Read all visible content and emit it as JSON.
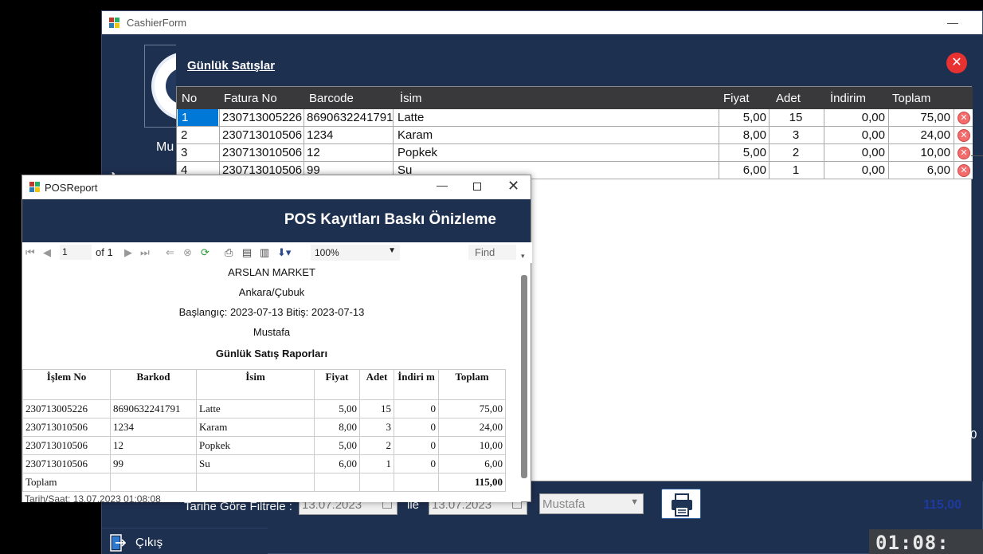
{
  "cashier": {
    "title": "CashierForm",
    "minimize": "—",
    "user_partial": "Mu",
    "exit_label": "Çıkış",
    "clock": "01:08:",
    "stray_text": "0"
  },
  "gunluk": {
    "title": "Günlük Satışlar",
    "close": "✕",
    "columns": [
      "No",
      "Fatura No",
      "Barcode",
      "İsim",
      "Fiyat",
      "Adet",
      "İndirim",
      "Toplam"
    ],
    "rows": [
      {
        "no": "1",
        "fatura": "230713005226",
        "barcode": "8690632241791",
        "isim": "Latte",
        "fiyat": "5,00",
        "adet": "15",
        "indirim": "0,00",
        "toplam": "75,00"
      },
      {
        "no": "2",
        "fatura": "230713010506",
        "barcode": "1234",
        "isim": "Karam",
        "fiyat": "8,00",
        "adet": "3",
        "indirim": "0,00",
        "toplam": "24,00"
      },
      {
        "no": "3",
        "fatura": "230713010506",
        "barcode": "12",
        "isim": "Popkek",
        "fiyat": "5,00",
        "adet": "2",
        "indirim": "0,00",
        "toplam": "10,00"
      },
      {
        "no": "4",
        "fatura": "230713010506",
        "barcode": "99",
        "isim": "Su",
        "fiyat": "6,00",
        "adet": "1",
        "indirim": "0,00",
        "toplam": "6,00"
      }
    ],
    "filter_label": "Tarihe Göre Filtrele :",
    "date_from": "13.07.2023",
    "ile": "ile",
    "date_to": "13.07.2023",
    "user_combo": "Mustafa",
    "total": "115,00"
  },
  "pos": {
    "title": "POSReport",
    "header_title": "POS Kayıtları Baskı Önizleme",
    "page": "1",
    "of": "of",
    "page_total": "1",
    "zoom": "100%",
    "find": "Find",
    "report": {
      "store": "ARSLAN MARKET",
      "location": "Ankara/Çubuk",
      "range": "Başlangıç: 2023-07-13 Bitiş: 2023-07-13",
      "user": "Mustafa",
      "heading": "Günlük Satış Raporları",
      "columns": [
        "İşlem No",
        "Barkod",
        "İsim",
        "Fiyat",
        "Adet",
        "İndiri m",
        "Toplam"
      ],
      "rows": [
        {
          "islem": "230713005226",
          "barkod": "8690632241791",
          "isim": "Latte",
          "fiyat": "5,00",
          "adet": "15",
          "indirim": "0",
          "toplam": "75,00"
        },
        {
          "islem": "230713010506",
          "barkod": "1234",
          "isim": "Karam",
          "fiyat": "8,00",
          "adet": "3",
          "indirim": "0",
          "toplam": "24,00"
        },
        {
          "islem": "230713010506",
          "barkod": "12",
          "isim": "Popkek",
          "fiyat": "5,00",
          "adet": "2",
          "indirim": "0",
          "toplam": "10,00"
        },
        {
          "islem": "230713010506",
          "barkod": "99",
          "isim": "Su",
          "fiyat": "6,00",
          "adet": "1",
          "indirim": "0",
          "toplam": "6,00"
        }
      ],
      "total_label": "Toplam",
      "total_value": "115,00",
      "footnote": "Tarih/Saat: 13.07.2023 01:08:08"
    }
  }
}
